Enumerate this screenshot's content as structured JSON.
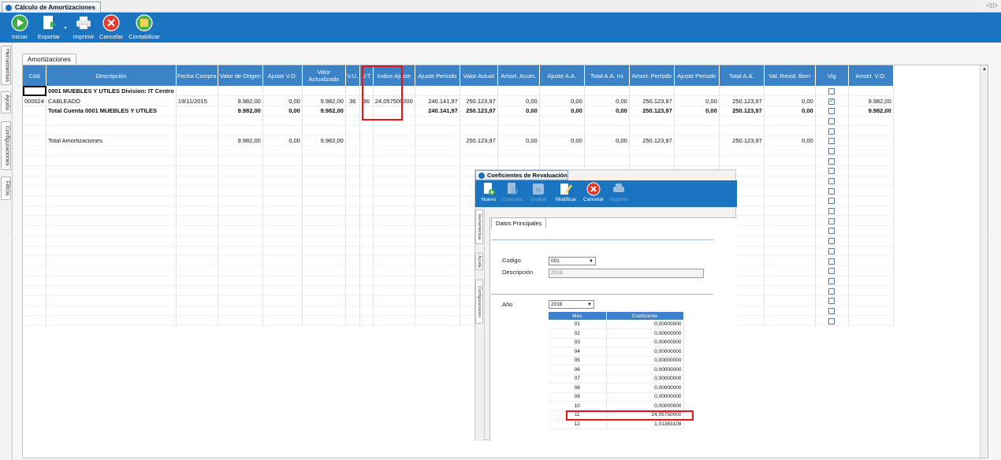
{
  "window": {
    "tab_title": "Cálculo de Amortizaciones",
    "nav_prev": "◁",
    "nav_next": "▷"
  },
  "toolbar": {
    "iniciar": "Iniciar",
    "exportar": "Exportar",
    "imprimir": "Imprimir",
    "cancelar": "Cancelar",
    "contabilizar": "Contabilizar"
  },
  "side_tabs": [
    "Herramientas",
    "Ayuda",
    "Configuraciones",
    "Filtros"
  ],
  "panel": {
    "sub_tab": "Amortizaciones"
  },
  "grid": {
    "columns": [
      "Cód",
      "Descripción",
      "Fecha Compra",
      "Valor de Origen",
      "Ajuste V.O.",
      "Valor Actualizado",
      "V.U.",
      "V.T",
      "Indice Ajuste",
      "Ajuste Período",
      "Valor Actual",
      "Amort. Acum.",
      "Ajuste A.A.",
      "Total A.A. Ini",
      "Amort. Período",
      "Ajuste Período",
      "Total A.A.",
      "Val. Resid. Bien",
      "Vig",
      "Amort. V.O."
    ],
    "rows": [
      {
        "type": "group",
        "cells": [
          "",
          "0001 MUEBLES Y UTILES Division: IT Centro",
          "",
          "",
          "",
          "",
          "",
          "",
          "",
          "",
          "",
          "",
          "",
          "",
          "",
          "",
          "",
          "",
          "",
          ""
        ],
        "vig": null
      },
      {
        "type": "item",
        "cells": [
          "000024",
          "CABLEADO",
          "19/11/2015",
          "9.982,00",
          "0,00",
          "9.982,00",
          "36",
          "36",
          "24,057500000",
          "240.141,97",
          "250.123,97",
          "0,00",
          "0,00",
          "0,00",
          "250.123,97",
          "0,00",
          "250.123,97",
          "0,00",
          "",
          "9.982,00"
        ],
        "vig": true
      },
      {
        "type": "total",
        "cells": [
          "",
          "Total Cuenta 0001 MUEBLES Y UTILES",
          "",
          "9.982,00",
          "0,00",
          "9.982,00",
          "",
          "",
          "",
          "240.141,97",
          "250.123,97",
          "0,00",
          "0,00",
          "0,00",
          "250.123,97",
          "0,00",
          "250.123,97",
          "0,00",
          "",
          "9.982,00"
        ],
        "vig": false
      },
      {
        "type": "empty",
        "cells": [
          "",
          "",
          "",
          "",
          "",
          "",
          "",
          "",
          "",
          "",
          "",
          "",
          "",
          "",
          "",
          "",
          "",
          "",
          "",
          ""
        ],
        "vig": false
      },
      {
        "type": "empty",
        "cells": [
          "",
          "",
          "",
          "",
          "",
          "",
          "",
          "",
          "",
          "",
          "",
          "",
          "",
          "",
          "",
          "",
          "",
          "",
          "",
          ""
        ],
        "vig": false
      },
      {
        "type": "grand",
        "cells": [
          "",
          "Total Amortizaciones",
          "",
          "9.982,00",
          "0,00",
          "9.982,00",
          "",
          "",
          "",
          "",
          "250.123,97",
          "0,00",
          "0,00",
          "0,00",
          "250.123,97",
          "",
          "250.123,97",
          "0,00",
          "",
          ""
        ],
        "vig": false
      }
    ]
  },
  "popup": {
    "title": "Coeficientes de Revaluación",
    "toolbar": {
      "nuevo": "Nuevo",
      "consulta": "Consulta",
      "grabar": "Grabar",
      "modificar": "Modificar",
      "cancelar": "Cancelar",
      "imprimir": "Imprimir"
    },
    "side_tabs": [
      "Herramientas",
      "Ayuda",
      "Configuraciones"
    ],
    "sub_tab": "Datos Principales",
    "codigo_label": "Codigo",
    "codigo_value": "001",
    "descripcion_label": "Descripción",
    "descripcion_value": "2018",
    "anio_label": "Año",
    "anio_value": "2018",
    "coef_table": {
      "columns": [
        "Mes",
        "Coeficiente"
      ],
      "rows": [
        [
          "01",
          "0,00000000"
        ],
        [
          "02",
          "0,00000000"
        ],
        [
          "03",
          "0,00000000"
        ],
        [
          "04",
          "0,00000000"
        ],
        [
          "05",
          "0,00000000"
        ],
        [
          "06",
          "0,00000000"
        ],
        [
          "07",
          "0,00000000"
        ],
        [
          "08",
          "0,00000000"
        ],
        [
          "09",
          "0,00000000"
        ],
        [
          "10",
          "0,00000000"
        ],
        [
          "11",
          "24,05750000"
        ],
        [
          "12",
          "1,01383108"
        ]
      ]
    }
  },
  "colors": {
    "toolbar": "#1a74bf",
    "grid_header": "#3b82c6",
    "highlight": "#e11111"
  }
}
